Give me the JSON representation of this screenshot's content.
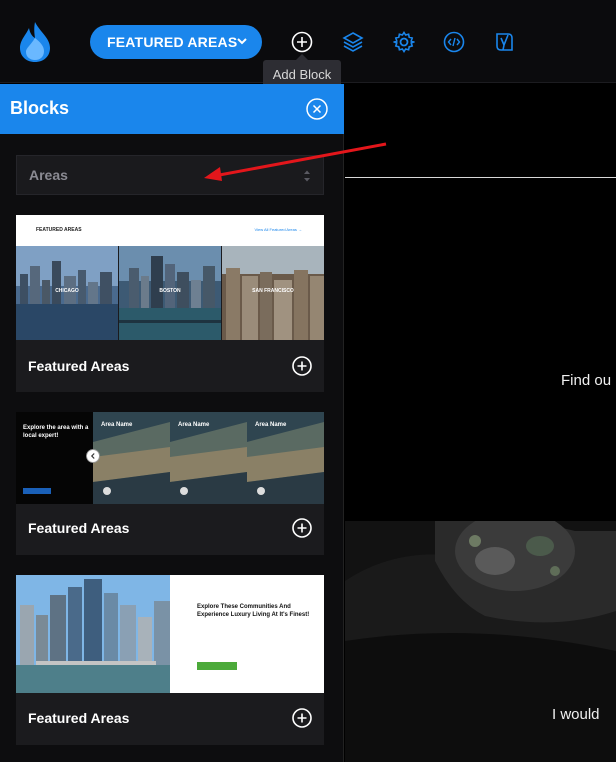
{
  "topbar": {
    "page_button_label": "FEATURED AREAS",
    "tools": [
      {
        "icon": "add-block-icon"
      },
      {
        "icon": "layers-icon"
      },
      {
        "icon": "gear-icon"
      },
      {
        "icon": "code-icon"
      },
      {
        "icon": "yoast-icon"
      }
    ],
    "tooltip": "Add Block"
  },
  "panel": {
    "title": "Blocks",
    "select_value": "Areas",
    "cards": [
      {
        "label": "Featured Areas",
        "preview": {
          "title": "FEATURED AREAS",
          "link": "View All Featured Areas →",
          "cities": [
            "CHICAGO",
            "BOSTON",
            "SAN FRANCISCO"
          ]
        }
      },
      {
        "label": "Featured Areas",
        "preview": {
          "heading": "Explore the area with a local expert!",
          "tiles": [
            "Area Name",
            "Area Name",
            "Area Name"
          ]
        }
      },
      {
        "label": "Featured Areas",
        "preview": {
          "heading": "Explore These Communities And Experience Luxury Living At It's Finest!"
        }
      }
    ]
  },
  "content": {
    "find_text": "Find ou",
    "would_text": "I would"
  },
  "colors": {
    "accent": "#1a86ec",
    "arrow": "#e3161b"
  }
}
